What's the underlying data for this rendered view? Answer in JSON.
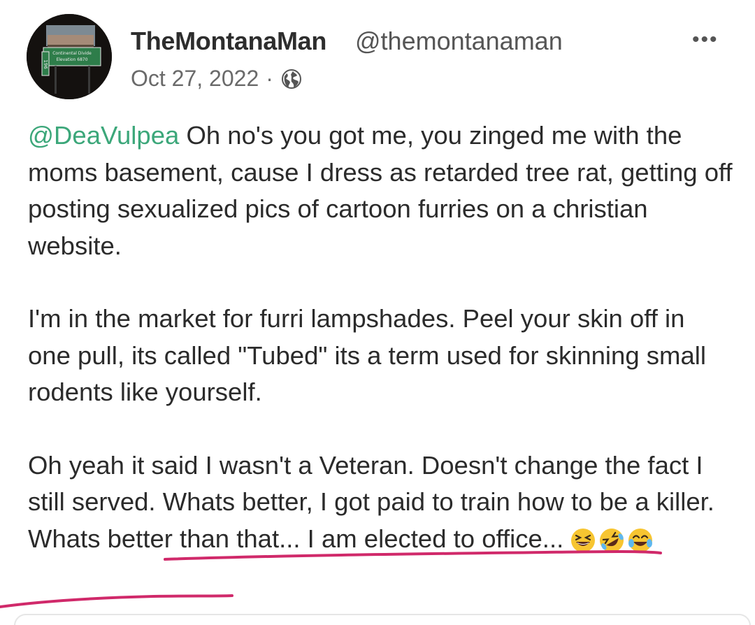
{
  "post": {
    "author_name": "TheMontanaMan",
    "author_handle": "@themontanaman",
    "date": "Oct 27, 2022",
    "separator": "·",
    "visibility_icon": "globe-icon",
    "more_label": "•••",
    "mention": "@DeaVulpea",
    "paragraph1_rest": " Oh no's you got me, you zinged me with the moms basement, cause I dress as retarded tree rat, getting off posting sexualized pics of cartoon furries on a christian website.",
    "paragraph2": "I'm in the market for furri lampshades. Peel your skin off in one pull, its called \"Tubed\" its a term used for skinning small rodents like yourself.",
    "paragraph3": "Oh yeah it said I wasn't a Veteran. Doesn't change the fact I still served. Whats better, I got paid to train how to be a killer. Whats better than that... I am elected to office...",
    "emojis": [
      "grinning-squinting-face-icon",
      "rolling-on-floor-laughing-icon",
      "face-with-tears-of-joy-icon"
    ]
  },
  "avatar": {
    "sign_line1": "Continental Divide",
    "sign_line2": "Elevation 6870",
    "route": "196"
  },
  "colors": {
    "mention": "#3ca77a",
    "annotation_underline": "#d0296a"
  }
}
